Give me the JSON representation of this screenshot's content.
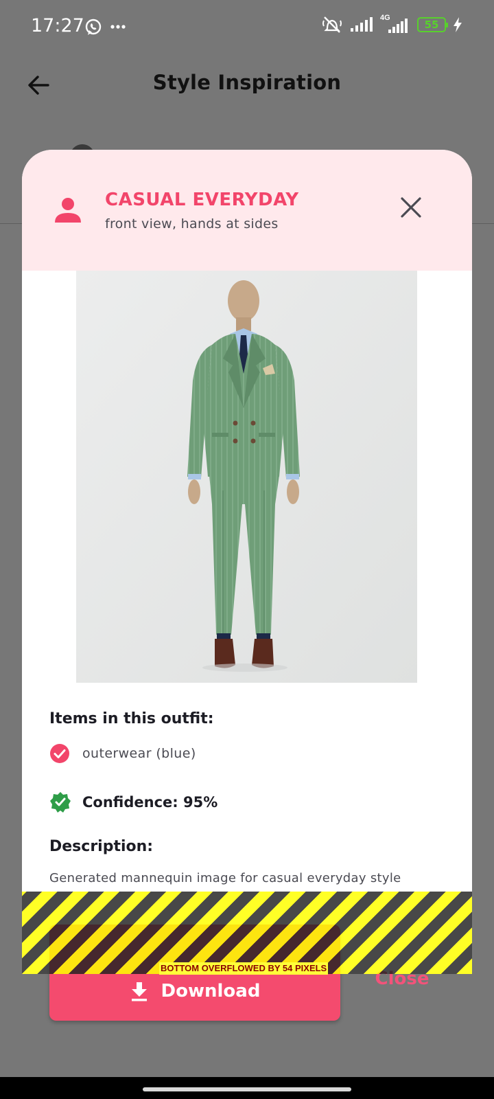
{
  "status_bar": {
    "time": "17:27",
    "network_label": "4G",
    "battery_level": "55"
  },
  "app_bar": {
    "title": "Style Inspiration"
  },
  "dialog": {
    "title": "CASUAL EVERYDAY",
    "subtitle": "front view, hands at sides",
    "items_heading": "Items in this outfit:",
    "items": [
      "outerwear (blue)"
    ],
    "confidence": "Confidence: 95%",
    "description_heading": "Description:",
    "description": "Generated mannequin image for casual everyday style"
  },
  "actions": {
    "download_label": "Download",
    "close_label": "Close"
  },
  "debug": {
    "overflow_message": "BOTTOM OVERFLOWED BY 54 PIXELS"
  },
  "colors": {
    "accent": "#f44b6e",
    "header_bg": "#ffe9ec",
    "verified": "#2e9d48",
    "scrim": "#777777"
  },
  "icons": [
    "back-arrow-icon",
    "person-icon",
    "close-icon",
    "check-circle-icon",
    "verified-icon",
    "download-icon",
    "whatsapp-icon",
    "more-icon",
    "mute-icon",
    "signal-icon",
    "battery-icon",
    "charging-icon"
  ]
}
